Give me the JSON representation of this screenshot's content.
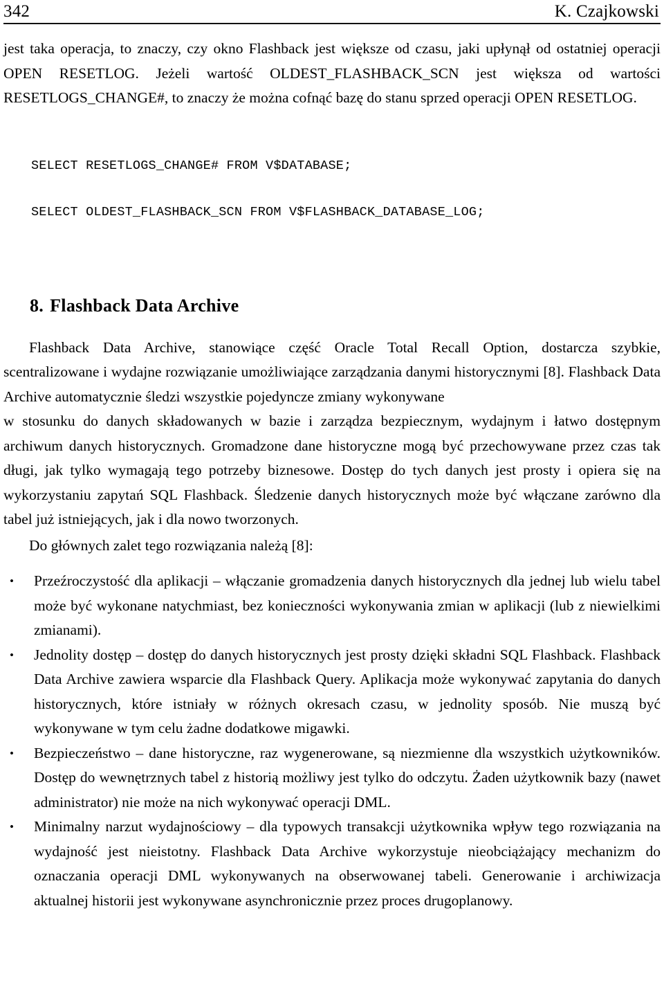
{
  "header": {
    "page_number": "342",
    "author": "K. Czajkowski"
  },
  "body": {
    "paragraph_1": "jest taka operacja, to znaczy, czy okno Flashback jest większe od czasu, jaki upłynął od ostatniej operacji OPEN RESETLOG. Jeżeli wartość OLDEST_FLASHBACK_SCN jest większa od wartości RESETLOGS_CHANGE#, to znaczy że można cofnąć bazę do stanu sprzed operacji OPEN RESETLOG.",
    "code_lines": [
      "SELECT RESETLOGS_CHANGE# FROM V$DATABASE;",
      "SELECT OLDEST_FLASHBACK_SCN FROM V$FLASHBACK_DATABASE_LOG;"
    ],
    "heading_number": "8.",
    "heading_title": "Flashback Data Archive",
    "paragraph_2": "Flashback Data Archive, stanowiące część Oracle Total Recall Option, dostarcza szybkie, scentralizowane i wydajne rozwiązanie umożliwiające zarządzania danymi historycznymi [8]. Flashback Data Archive automatycznie śledzi wszystkie pojedyncze zmiany wykonywane",
    "paragraph_3": "w stosunku do danych składowanych w bazie i zarządza bezpiecznym, wydajnym i łatwo dostępnym archiwum danych historycznych. Gromadzone dane historyczne mogą być przechowywane przez czas tak długi, jak tylko wymagają tego potrzeby biznesowe. Dostęp do tych danych jest prosty i opiera się na wykorzystaniu zapytań SQL Flashback. Śledzenie danych historycznych może być włączane zarówno dla tabel już istniejących, jak i dla nowo tworzonych.",
    "paragraph_4": "Do głównych zalet tego rozwiązania należą [8]:",
    "bullet_marker": "•",
    "bullets": [
      "Przeźroczystość dla aplikacji – włączanie gromadzenia danych historycznych dla jednej lub wielu tabel może być wykonane natychmiast, bez konieczności wykonywania zmian w aplikacji (lub z niewielkimi zmianami).",
      "Jednolity dostęp – dostęp do danych historycznych jest prosty dzięki składni SQL Flashback. Flashback Data Archive zawiera wsparcie dla Flashback Query. Aplikacja może wykonywać zapytania do danych historycznych, które istniały w różnych okresach czasu, w jednolity sposób. Nie muszą być wykonywane w tym celu żadne dodatkowe migawki.",
      "Bezpieczeństwo – dane historyczne, raz wygenerowane, są niezmienne dla wszystkich użytkowników. Dostęp do wewnętrznych tabel z historią możliwy jest tylko do odczytu. Żaden użytkownik bazy (nawet administrator) nie może na nich wykonywać operacji DML.",
      "Minimalny narzut wydajnościowy – dla typowych transakcji użytkownika wpływ tego rozwiązania na wydajność jest nieistotny. Flashback Data Archive wykorzystuje nieobciążający mechanizm do oznaczania operacji DML wykonywanych na obserwowanej tabeli. Generowanie i archiwizacja aktualnej historii jest wykonywane asynchronicznie przez proces drugoplanowy."
    ]
  }
}
